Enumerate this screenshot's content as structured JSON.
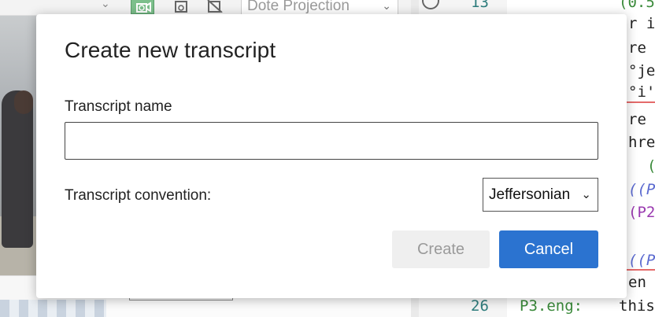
{
  "background": {
    "projection_select": "Dote Projection",
    "editor": {
      "line_numbers": [
        "13",
        "26"
      ],
      "code_fragments": [
        "(0.5",
        "r i",
        "re",
        "°je",
        "°i'",
        "re",
        "hre",
        "(",
        "((P",
        "(P2",
        "((P",
        "en",
        "P3.eng:",
        "this"
      ]
    }
  },
  "dialog": {
    "title": "Create new transcript",
    "name_label": "Transcript name",
    "name_value": "",
    "name_placeholder": "",
    "convention_label": "Transcript convention:",
    "convention_selected": "Jeffersonian",
    "create_label": "Create",
    "cancel_label": "Cancel"
  },
  "colors": {
    "primary_button": "#2b73d0",
    "disabled_button": "#efefef",
    "toolbar_active": "#7cbf8b"
  },
  "icons": [
    "chevron-down-icon",
    "video-sync-icon",
    "save-sync-icon",
    "no-video-icon",
    "crosshair-icon"
  ]
}
